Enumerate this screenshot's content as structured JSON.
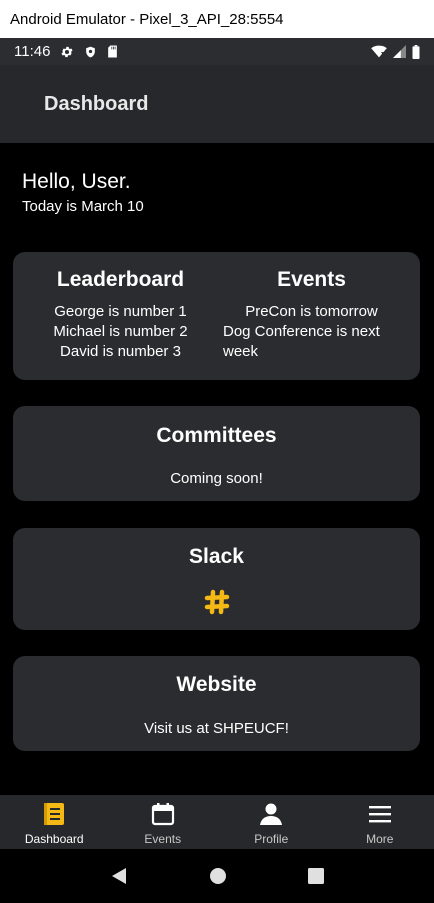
{
  "window": {
    "title": "Android Emulator - Pixel_3_API_28:5554"
  },
  "status_bar": {
    "time": "11:46"
  },
  "app_bar": {
    "title": "Dashboard"
  },
  "greeting": {
    "hello": "Hello, User.",
    "date": "Today is March 10"
  },
  "leaderboard": {
    "title": "Leaderboard",
    "items": [
      "George is number 1",
      "Michael is number 2",
      "David is number 3"
    ]
  },
  "events": {
    "title": "Events",
    "items": [
      "PreCon is tomorrow",
      "Dog Conference is next week"
    ]
  },
  "committees": {
    "title": "Committees",
    "text": "Coming soon!"
  },
  "slack": {
    "title": "Slack",
    "icon": "slack-hash-icon"
  },
  "website": {
    "title": "Website",
    "text": "Visit us at SHPEUCF!"
  },
  "bottom_nav": {
    "items": [
      {
        "label": "Dashboard",
        "icon": "dashboard-icon"
      },
      {
        "label": "Events",
        "icon": "calendar-icon"
      },
      {
        "label": "Profile",
        "icon": "person-icon"
      },
      {
        "label": "More",
        "icon": "menu-icon"
      }
    ],
    "active": "Dashboard"
  },
  "colors": {
    "accent": "#f5b915",
    "card": "#2a2c2f",
    "app_bar": "#26282b",
    "background": "#000000"
  }
}
